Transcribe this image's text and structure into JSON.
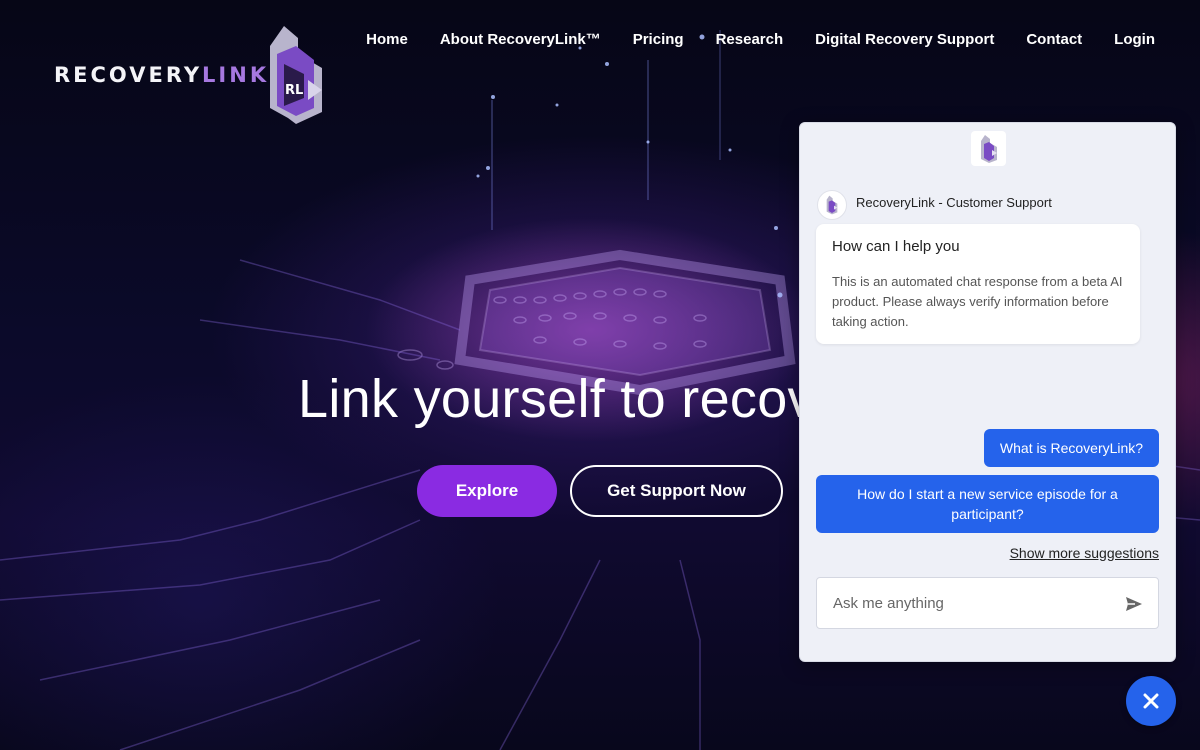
{
  "brand": {
    "logo_main": "RECOVERY",
    "logo_accent": "LINK",
    "logo_mark": "RL"
  },
  "nav": [
    "Home",
    "About RecoveryLink™",
    "Pricing",
    "Research",
    "Digital Recovery Support",
    "Contact",
    "Login"
  ],
  "hero": {
    "title": "Link yourself to recov",
    "explore_label": "Explore",
    "support_label": "Get Support Now"
  },
  "chat": {
    "agent_name": "RecoveryLink - Customer Support",
    "greeting": "How can I help you",
    "disclaimer": "This is an automated chat response from a beta AI product. Please always verify information before taking action.",
    "suggestions": [
      "What is RecoveryLink?",
      "How do I start a new service episode for a participant?"
    ],
    "show_more": "Show more suggestions",
    "input_placeholder": "Ask me anything"
  },
  "icons": {
    "send": "send-icon",
    "close": "close-icon"
  },
  "colors": {
    "accent_purple": "#8a2be2",
    "chat_blue": "#2563eb",
    "logo_purple": "#a678e0"
  }
}
